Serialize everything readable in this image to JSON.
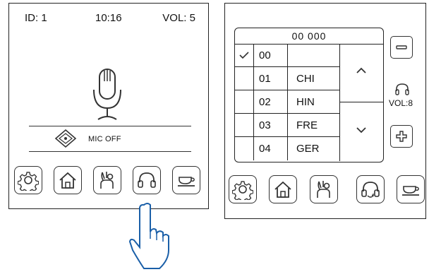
{
  "left_panel": {
    "status": {
      "id": "ID: 1",
      "time": "10:16",
      "vol": "VOL: 5"
    },
    "mic_state_label": "MIC OFF",
    "buttons": [
      {
        "icon": "gear-icon"
      },
      {
        "icon": "home-icon"
      },
      {
        "icon": "raise-hand-icon"
      },
      {
        "icon": "headset-icon"
      },
      {
        "icon": "coffee-cup-icon"
      }
    ]
  },
  "right_panel": {
    "table_header": "00 000",
    "channels": [
      {
        "num": "00",
        "lang": "",
        "selected": true
      },
      {
        "num": "01",
        "lang": "CHI",
        "selected": false
      },
      {
        "num": "02",
        "lang": "HIN",
        "selected": false
      },
      {
        "num": "03",
        "lang": "FRE",
        "selected": false
      },
      {
        "num": "04",
        "lang": "GER",
        "selected": false
      }
    ],
    "volume_label": "VOL:8",
    "buttons": [
      {
        "icon": "gear-icon"
      },
      {
        "icon": "home-icon"
      },
      {
        "icon": "raise-hand-icon"
      },
      {
        "icon": "headset-refresh-icon"
      },
      {
        "icon": "coffee-cup-icon"
      }
    ]
  },
  "colors": {
    "stroke": "#222222",
    "background": "#ffffff"
  }
}
